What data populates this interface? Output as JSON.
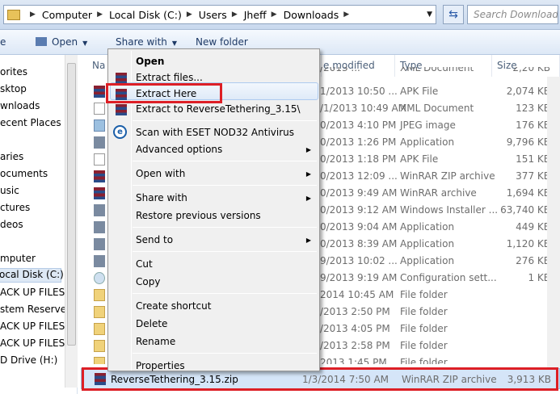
{
  "address": {
    "crumbs": [
      "Computer",
      "Local Disk (C:)",
      "Users",
      "Jheff",
      "Downloads"
    ],
    "search_placeholder": "Search Downloads"
  },
  "toolbar": {
    "open": "Open",
    "share": "Share with",
    "new_folder": "New folder"
  },
  "columns": {
    "name": "Na",
    "date": "e modified",
    "type": "Type",
    "size": "Size"
  },
  "nav": [
    "orites",
    "sktop",
    "wnloads",
    "ecent Places",
    "aries",
    "ocuments",
    "usic",
    "ctures",
    "deos",
    "mputer",
    "ocal Disk (C:)",
    "ACK UP FILES 3",
    "stem Reserved",
    "ACK UP FILES 1",
    "ACK UP FILES 2",
    "D Drive (H:)"
  ],
  "rows": [
    {
      "icon": "rar-icon",
      "date": "1/2013 10:50 ...",
      "type": "APK File",
      "size": "2,074 KB"
    },
    {
      "icon": "doc-icon",
      "date": "/1/2013 10:49 AM",
      "type": "XML Document",
      "size": "123 KB"
    },
    {
      "icon": "image-icon",
      "date": "0/2013 4:10 PM",
      "type": "JPEG image",
      "size": "176 KB"
    },
    {
      "icon": "app-icon",
      "date": "0/2013 1:26 PM",
      "type": "Application",
      "size": "9,796 KB"
    },
    {
      "icon": "doc-icon",
      "date": "0/2013 1:18 PM",
      "type": "APK File",
      "size": "151 KB"
    },
    {
      "icon": "rar-icon",
      "date": "0/2013 12:09 ...",
      "type": "WinRAR ZIP archive",
      "size": "377 KB"
    },
    {
      "icon": "rar-icon",
      "date": "0/2013 9:49 AM",
      "type": "WinRAR archive",
      "size": "1,694 KB"
    },
    {
      "icon": "app-icon",
      "date": "0/2013 9:12 AM",
      "type": "Windows Installer ...",
      "size": "63,740 KB"
    },
    {
      "icon": "app-icon",
      "date": "0/2013 9:04 AM",
      "type": "Application",
      "size": "449 KB"
    },
    {
      "icon": "app-icon",
      "date": "0/2013 8:39 AM",
      "type": "Application",
      "size": "1,120 KB"
    },
    {
      "icon": "app-icon",
      "date": "9/2013 10:02 ...",
      "type": "Application",
      "size": "276 KB"
    },
    {
      "icon": "config-icon",
      "date": "9/2013 9:19 AM",
      "type": "Configuration sett...",
      "size": "1 KB"
    },
    {
      "icon": "folder-icon",
      "date": "2014 10:45 AM",
      "type": "File folder",
      "size": ""
    },
    {
      "icon": "folder-icon",
      "date": "/2013 2:50 PM",
      "type": "File folder",
      "size": ""
    },
    {
      "icon": "folder-icon",
      "date": "/2013 4:05 PM",
      "type": "File folder",
      "size": ""
    },
    {
      "icon": "folder-icon",
      "date": "/2013 2:58 PM",
      "type": "File folder",
      "size": ""
    },
    {
      "icon": "folder-icon",
      "date": "2013 1:45 PM",
      "type": "File folder",
      "size": ""
    }
  ],
  "top_partial": {
    "date": "/2013 ...",
    "type": "XML Document",
    "size": "2,20 KB"
  },
  "selected": {
    "name": "ReverseTethering_3.15.zip",
    "date": "1/3/2014 7:50 AM",
    "type": "WinRAR ZIP archive",
    "size": "3,913 KB"
  },
  "menu": {
    "open": "Open",
    "extract_files": "Extract files...",
    "extract_here": "Extract Here",
    "extract_to": "Extract to ReverseTethering_3.15\\",
    "scan": "Scan with ESET NOD32 Antivirus",
    "advanced": "Advanced options",
    "open_with": "Open with",
    "share_with": "Share with",
    "restore": "Restore previous versions",
    "send_to": "Send to",
    "cut": "Cut",
    "copy": "Copy",
    "create_shortcut": "Create shortcut",
    "delete": "Delete",
    "rename": "Rename",
    "properties": "Properties"
  },
  "colors": {
    "highlight_red": "#dd1f26",
    "selection": "#d5e5f8"
  }
}
